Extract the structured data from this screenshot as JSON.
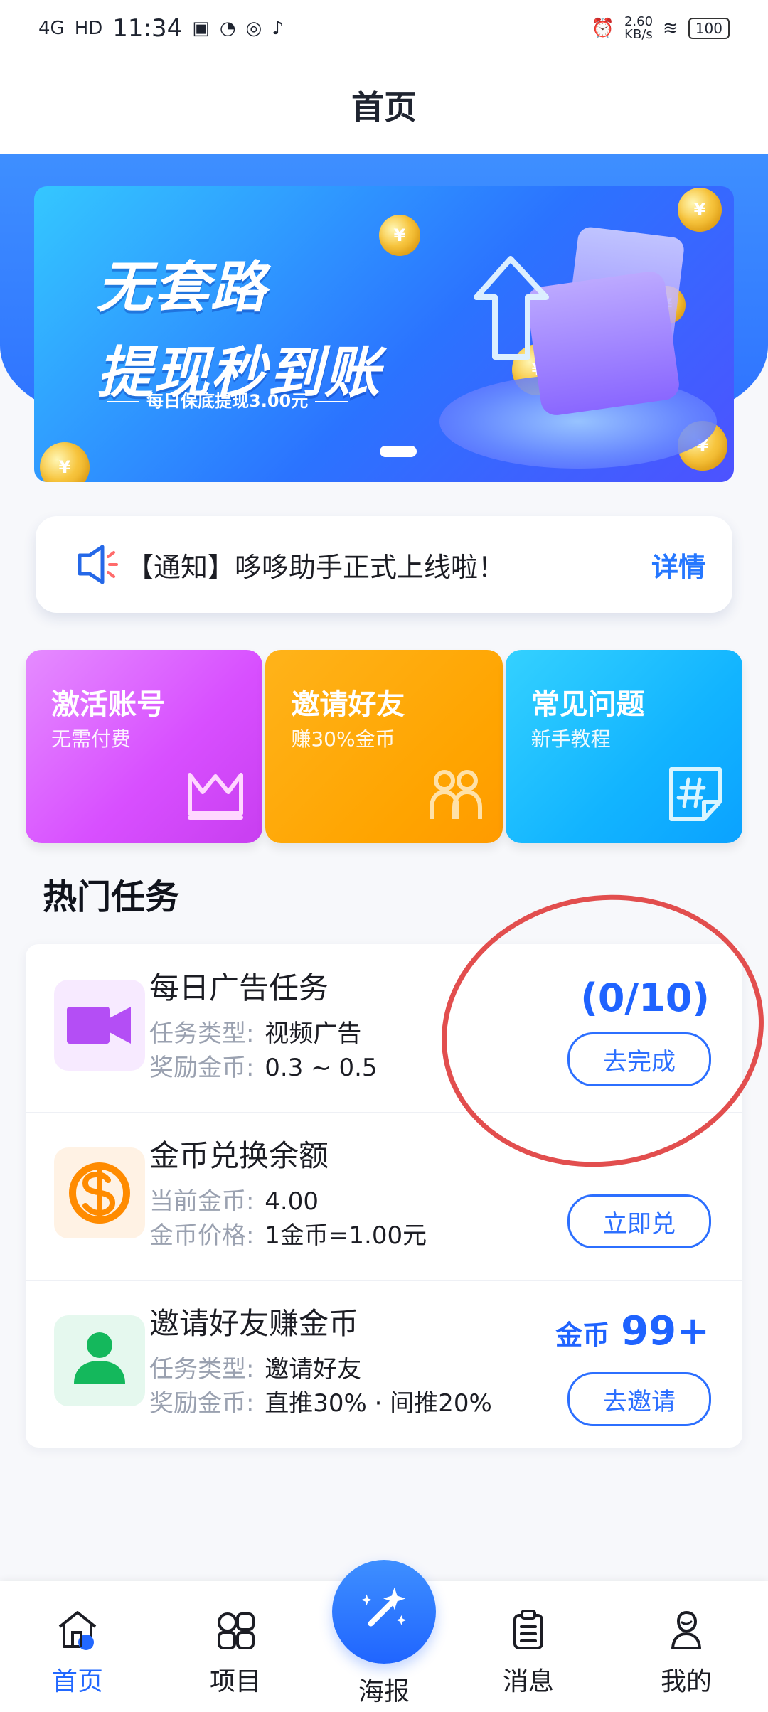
{
  "status_bar": {
    "time": "11:34",
    "network": "4G",
    "hd": "HD",
    "speed": "2.60",
    "speed_unit": "KB/s",
    "battery": "100"
  },
  "header": {
    "title": "首页"
  },
  "banner": {
    "line1": "无套路",
    "line2": "提现秒到账",
    "subtitle": "每日保底提现3.00元",
    "coin_symbol": "¥"
  },
  "notice": {
    "text": "【通知】哆哆助手正式上线啦！",
    "detail": "详情"
  },
  "quick_actions": [
    {
      "title": "激活账号",
      "subtitle": "无需付费",
      "icon": "crown-icon"
    },
    {
      "title": "邀请好友",
      "subtitle": "赚30%金币",
      "icon": "friends-icon"
    },
    {
      "title": "常见问题",
      "subtitle": "新手教程",
      "icon": "hashtag-note-icon"
    }
  ],
  "section": {
    "title": "热门任务"
  },
  "tasks": [
    {
      "title": "每日广告任务",
      "line1_label": "任务类型:",
      "line1_value": "视频广告",
      "line2_label": "奖励金币:",
      "line2_value": "0.3 ~ 0.5",
      "right_text": "(0/10)",
      "button": "去完成",
      "icon": "video-camera-icon"
    },
    {
      "title": "金币兑换余额",
      "line1_label": "当前金币:",
      "line1_value": "4.00",
      "line2_label": "金币价格:",
      "line2_value": "1金币=1.00元",
      "button": "立即兑",
      "icon": "dollar-coin-icon"
    },
    {
      "title": "邀请好友赚金币",
      "line1_label": "任务类型:",
      "line1_value": "邀请好友",
      "line2_label": "奖励金币:",
      "line2_value": "直推30% · 间推20%",
      "right_small": "金币",
      "right_big": "99+",
      "button": "去邀请",
      "icon": "user-icon"
    }
  ],
  "bottom_nav": {
    "home": "首页",
    "project": "项目",
    "poster": "海报",
    "message": "消息",
    "mine": "我的"
  },
  "colors": {
    "primary": "#2c6fff",
    "annotation": "#e24e4e"
  }
}
